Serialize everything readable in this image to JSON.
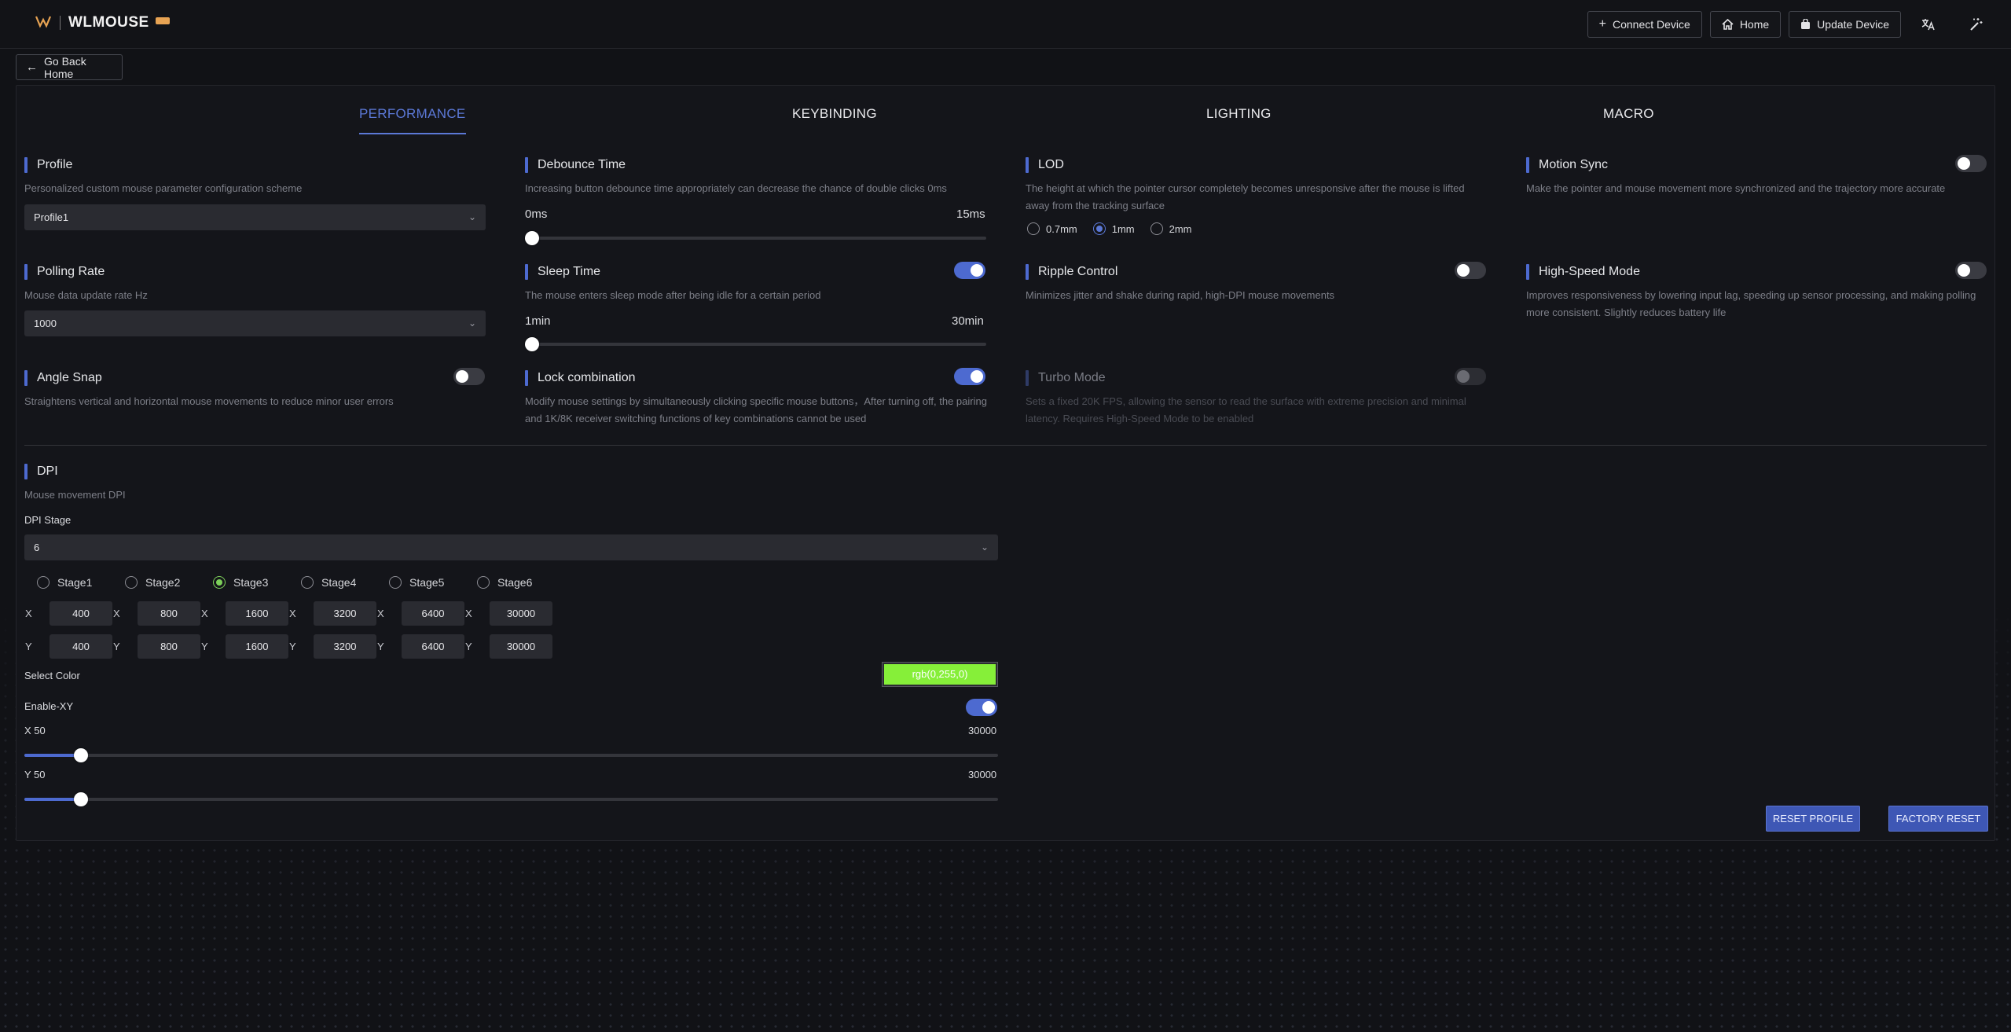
{
  "brand": {
    "logo_text": "WLMOUSE"
  },
  "topbar": {
    "connect_label": "Connect Device",
    "home_label": "Home",
    "update_label": "Update Device"
  },
  "back_label": "Go Back Home",
  "tabs": [
    {
      "label": "PERFORMANCE",
      "active": true
    },
    {
      "label": "KEYBINDING",
      "active": false
    },
    {
      "label": "LIGHTING",
      "active": false
    },
    {
      "label": "MACRO",
      "active": false
    }
  ],
  "profile": {
    "title": "Profile",
    "desc": "Personalized custom mouse parameter configuration scheme",
    "value": "Profile1"
  },
  "debounce": {
    "title": "Debounce Time",
    "desc": "Increasing button debounce time appropriately can decrease the chance of double clicks 0ms",
    "min_label": "0ms",
    "max_label": "15ms",
    "value": 0
  },
  "lod": {
    "title": "LOD",
    "desc": "The height at which the pointer cursor completely becomes unresponsive after the mouse is lifted away from the tracking surface",
    "options": [
      "0.7mm",
      "1mm",
      "2mm"
    ],
    "selected": "1mm"
  },
  "motion_sync": {
    "title": "Motion Sync",
    "desc": "Make the pointer and mouse movement more synchronized and the trajectory more accurate",
    "enabled": false
  },
  "polling": {
    "title": "Polling Rate",
    "desc": "Mouse data update rate Hz",
    "value": "1000"
  },
  "sleep": {
    "title": "Sleep Time",
    "desc": "The mouse enters sleep mode after being idle for a certain period",
    "min_label": "1min",
    "max_label": "30min",
    "enabled": true,
    "value": 0
  },
  "ripple": {
    "title": "Ripple Control",
    "desc": "Minimizes jitter and shake during rapid, high-DPI mouse movements",
    "enabled": false
  },
  "high_speed": {
    "title": "High-Speed Mode",
    "desc": "Improves responsiveness by lowering input lag, speeding up sensor processing, and making polling more consistent. Slightly reduces battery life",
    "enabled": false
  },
  "angle_snap": {
    "title": "Angle Snap",
    "desc": "Straightens vertical and horizontal mouse movements to reduce minor user errors",
    "enabled": false
  },
  "lock_combo": {
    "title": "Lock combination",
    "desc": "Modify mouse settings by simultaneously clicking specific mouse buttons，After turning off, the pairing and 1K/8K receiver switching functions of key combinations cannot be used",
    "enabled": true
  },
  "turbo": {
    "title": "Turbo Mode",
    "desc": "Sets a fixed 20K FPS, allowing the sensor to read the surface with extreme precision and minimal latency. Requires High-Speed Mode to be enabled",
    "enabled": false,
    "disabled": true
  },
  "dpi": {
    "title": "DPI",
    "desc": "Mouse movement DPI",
    "stage_label": "DPI Stage",
    "stage_count": "6",
    "stages": [
      "Stage1",
      "Stage2",
      "Stage3",
      "Stage4",
      "Stage5",
      "Stage6"
    ],
    "selected_stage": "Stage3",
    "x_label": "X",
    "y_label": "Y",
    "x_values": [
      "400",
      "800",
      "1600",
      "3200",
      "6400",
      "30000"
    ],
    "y_values": [
      "400",
      "800",
      "1600",
      "3200",
      "6400",
      "30000"
    ],
    "select_color_label": "Select Color",
    "color_value": "rgb(0,255,0)",
    "color_hex": "#86ef39",
    "enable_xy_label": "Enable-XY",
    "enable_xy": true,
    "x_slider_label": "X 50",
    "x_slider_max": "30000",
    "x_slider_value": 50,
    "y_slider_label": "Y 50",
    "y_slider_max": "30000",
    "y_slider_value": 50
  },
  "actions": {
    "reset_profile": "RESET PROFILE",
    "factory_reset": "FACTORY RESET"
  },
  "colors": {
    "accent": "#4d6ad0",
    "tab_active": "#5b78d6",
    "stage_selected": "#7dd05a"
  }
}
